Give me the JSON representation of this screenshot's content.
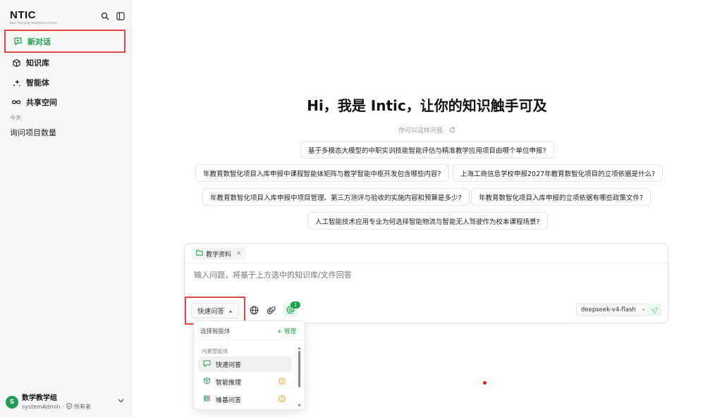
{
  "brand": {
    "name": "NTIC",
    "tagline": "Next Teaching Intelligence Center"
  },
  "nav": [
    {
      "label": "新对话",
      "icon": "new-chat-icon",
      "active": true
    },
    {
      "label": "知识库",
      "icon": "box-icon"
    },
    {
      "label": "智能体",
      "icon": "sparkle-icon"
    },
    {
      "label": "共享空间",
      "icon": "infinity-icon"
    }
  ],
  "history": {
    "section": "今天",
    "items": [
      "询问项目数量"
    ]
  },
  "user": {
    "initial": "S",
    "name": "数学教学组",
    "account": "systemAdmin",
    "sep": "·",
    "role": "所有者"
  },
  "main": {
    "greeting": "Hi，我是 Intic，让你的知识触手可及",
    "ask_hint": "你可以这样问我",
    "suggestions": [
      "基于多模态大模型的中职实训技能智能评估与精准教学应用项目由哪个单位申报?",
      "年教育数智化项目入库申报中课程智能体矩阵与教学智能中枢开发包含哪些内容?",
      "上海工商信息学校申报2027年教育数智化项目的立项依据是什么?",
      "年教育数智化项目入库申报中项目管理、第三方测评与验收的实施内容和预算是多少?",
      "年教育数智化项目入库申报的立项依据有哪些政策文件?",
      "人工智能技术应用专业为何选择智能物流与智能无人驾驶作为校本课程场景?"
    ]
  },
  "composer": {
    "kb_tag": "教学资料",
    "placeholder": "输入问题，将基于上方选中的知识库/文件回答",
    "mode": "快速问答",
    "badge_count": "1",
    "model": "deepseek-v4-flash"
  },
  "dropdown": {
    "header": "选择智能体",
    "manage": "+ 管理",
    "group": "内置智能体",
    "items": [
      {
        "label": "快速问答",
        "icon": "chat-icon",
        "selected": true
      },
      {
        "label": "智能推理",
        "icon": "cube-icon"
      },
      {
        "label": "维基问答",
        "icon": "book-icon"
      }
    ]
  }
}
